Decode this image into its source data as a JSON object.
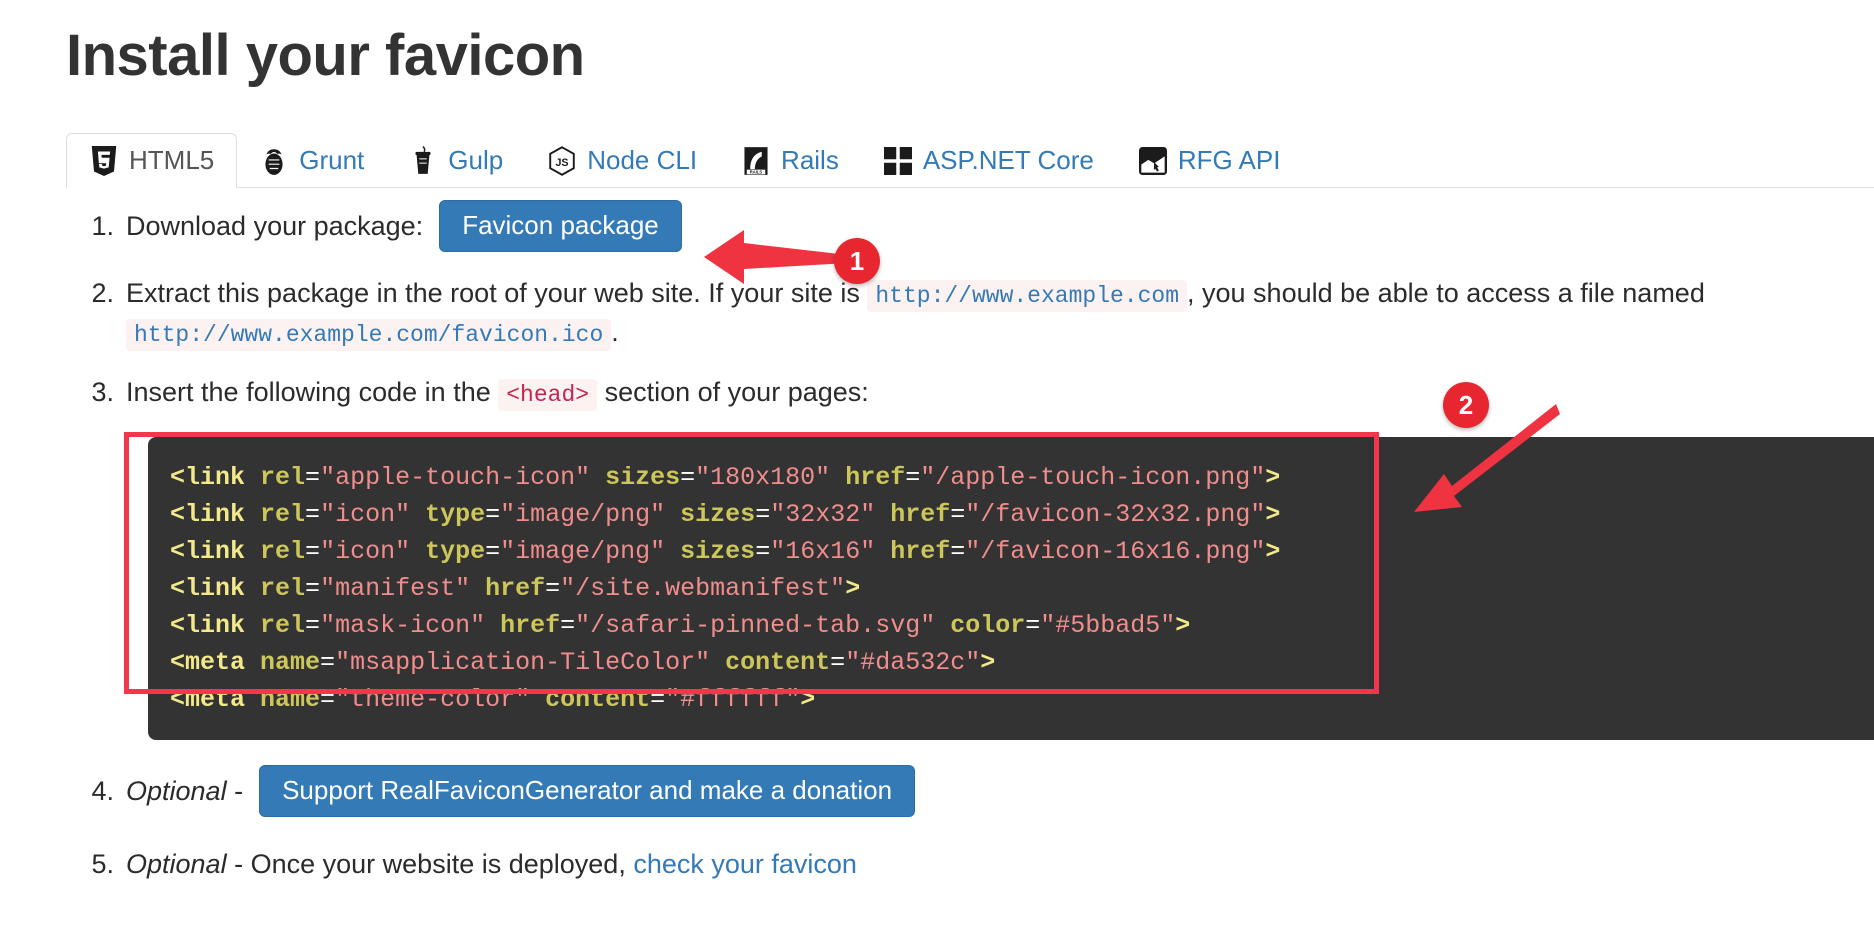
{
  "page": {
    "title": "Install your favicon",
    "accent_blue": "#337ab7",
    "annotation_red": "#e8262f",
    "code_bg": "#333333"
  },
  "tabs": [
    {
      "label": "HTML5",
      "icon": "html5-icon",
      "active": true
    },
    {
      "label": "Grunt",
      "icon": "grunt-icon",
      "active": false
    },
    {
      "label": "Gulp",
      "icon": "gulp-icon",
      "active": false
    },
    {
      "label": "Node CLI",
      "icon": "nodejs-icon",
      "active": false
    },
    {
      "label": "Rails",
      "icon": "rails-icon",
      "active": false
    },
    {
      "label": "ASP.NET Core",
      "icon": "windows-icon",
      "active": false
    },
    {
      "label": "RFG API",
      "icon": "rfg-api-icon",
      "active": false
    }
  ],
  "steps": {
    "step1": {
      "number": "1.",
      "text": "Download your package:",
      "button_label": "Favicon package"
    },
    "step2": {
      "number": "2.",
      "text_before": "Extract this package in the root of your web site. If your site is",
      "code_site": "http://www.example.com",
      "text_middle": ", you should be able to access a file named",
      "code_file": "http://www.example.com/favicon.ico",
      "text_end": "."
    },
    "step3": {
      "number": "3.",
      "text_before": "Insert the following code in the",
      "code_head": "<head>",
      "text_after": "section of your pages:"
    },
    "step4": {
      "number": "4.",
      "optional_label": "Optional",
      "dash": "-",
      "button_label": "Support RealFaviconGenerator and make a donation"
    },
    "step5": {
      "number": "5.",
      "optional_label": "Optional",
      "dash": "-",
      "text": "Once your website is deployed,",
      "link_label": "check your favicon"
    }
  },
  "code_block": {
    "language": "html",
    "lines": [
      [
        {
          "t": "tag",
          "s": "<link"
        },
        {
          "t": "sp",
          "s": " "
        },
        {
          "t": "attr",
          "s": "rel"
        },
        {
          "t": "eq",
          "s": "="
        },
        {
          "t": "val",
          "s": "\"apple-touch-icon\""
        },
        {
          "t": "sp",
          "s": " "
        },
        {
          "t": "attr",
          "s": "sizes"
        },
        {
          "t": "eq",
          "s": "="
        },
        {
          "t": "val",
          "s": "\"180x180\""
        },
        {
          "t": "sp",
          "s": " "
        },
        {
          "t": "attr",
          "s": "href"
        },
        {
          "t": "eq",
          "s": "="
        },
        {
          "t": "val",
          "s": "\"/apple-touch-icon.png\""
        },
        {
          "t": "tag",
          "s": ">"
        }
      ],
      [
        {
          "t": "tag",
          "s": "<link"
        },
        {
          "t": "sp",
          "s": " "
        },
        {
          "t": "attr",
          "s": "rel"
        },
        {
          "t": "eq",
          "s": "="
        },
        {
          "t": "val",
          "s": "\"icon\""
        },
        {
          "t": "sp",
          "s": " "
        },
        {
          "t": "attr",
          "s": "type"
        },
        {
          "t": "eq",
          "s": "="
        },
        {
          "t": "val",
          "s": "\"image/png\""
        },
        {
          "t": "sp",
          "s": " "
        },
        {
          "t": "attr",
          "s": "sizes"
        },
        {
          "t": "eq",
          "s": "="
        },
        {
          "t": "val",
          "s": "\"32x32\""
        },
        {
          "t": "sp",
          "s": " "
        },
        {
          "t": "attr",
          "s": "href"
        },
        {
          "t": "eq",
          "s": "="
        },
        {
          "t": "val",
          "s": "\"/favicon-32x32.png\""
        },
        {
          "t": "tag",
          "s": ">"
        }
      ],
      [
        {
          "t": "tag",
          "s": "<link"
        },
        {
          "t": "sp",
          "s": " "
        },
        {
          "t": "attr",
          "s": "rel"
        },
        {
          "t": "eq",
          "s": "="
        },
        {
          "t": "val",
          "s": "\"icon\""
        },
        {
          "t": "sp",
          "s": " "
        },
        {
          "t": "attr",
          "s": "type"
        },
        {
          "t": "eq",
          "s": "="
        },
        {
          "t": "val",
          "s": "\"image/png\""
        },
        {
          "t": "sp",
          "s": " "
        },
        {
          "t": "attr",
          "s": "sizes"
        },
        {
          "t": "eq",
          "s": "="
        },
        {
          "t": "val",
          "s": "\"16x16\""
        },
        {
          "t": "sp",
          "s": " "
        },
        {
          "t": "attr",
          "s": "href"
        },
        {
          "t": "eq",
          "s": "="
        },
        {
          "t": "val",
          "s": "\"/favicon-16x16.png\""
        },
        {
          "t": "tag",
          "s": ">"
        }
      ],
      [
        {
          "t": "tag",
          "s": "<link"
        },
        {
          "t": "sp",
          "s": " "
        },
        {
          "t": "attr",
          "s": "rel"
        },
        {
          "t": "eq",
          "s": "="
        },
        {
          "t": "val",
          "s": "\"manifest\""
        },
        {
          "t": "sp",
          "s": " "
        },
        {
          "t": "attr",
          "s": "href"
        },
        {
          "t": "eq",
          "s": "="
        },
        {
          "t": "val",
          "s": "\"/site.webmanifest\""
        },
        {
          "t": "tag",
          "s": ">"
        }
      ],
      [
        {
          "t": "tag",
          "s": "<link"
        },
        {
          "t": "sp",
          "s": " "
        },
        {
          "t": "attr",
          "s": "rel"
        },
        {
          "t": "eq",
          "s": "="
        },
        {
          "t": "val",
          "s": "\"mask-icon\""
        },
        {
          "t": "sp",
          "s": " "
        },
        {
          "t": "attr",
          "s": "href"
        },
        {
          "t": "eq",
          "s": "="
        },
        {
          "t": "val",
          "s": "\"/safari-pinned-tab.svg\""
        },
        {
          "t": "sp",
          "s": " "
        },
        {
          "t": "attr",
          "s": "color"
        },
        {
          "t": "eq",
          "s": "="
        },
        {
          "t": "val",
          "s": "\"#5bbad5\""
        },
        {
          "t": "tag",
          "s": ">"
        }
      ],
      [
        {
          "t": "tag",
          "s": "<meta"
        },
        {
          "t": "sp",
          "s": " "
        },
        {
          "t": "attr",
          "s": "name"
        },
        {
          "t": "eq",
          "s": "="
        },
        {
          "t": "val",
          "s": "\"msapplication-TileColor\""
        },
        {
          "t": "sp",
          "s": " "
        },
        {
          "t": "attr",
          "s": "content"
        },
        {
          "t": "eq",
          "s": "="
        },
        {
          "t": "val",
          "s": "\"#da532c\""
        },
        {
          "t": "tag",
          "s": ">"
        }
      ],
      [
        {
          "t": "tag",
          "s": "<meta"
        },
        {
          "t": "sp",
          "s": " "
        },
        {
          "t": "attr",
          "s": "name"
        },
        {
          "t": "eq",
          "s": "="
        },
        {
          "t": "val",
          "s": "\"theme-color\""
        },
        {
          "t": "sp",
          "s": " "
        },
        {
          "t": "attr",
          "s": "content"
        },
        {
          "t": "eq",
          "s": "="
        },
        {
          "t": "val",
          "s": "\"#ffffff\""
        },
        {
          "t": "tag",
          "s": ">"
        }
      ]
    ]
  },
  "annotations": [
    {
      "label": "1",
      "target": "favicon-package-button"
    },
    {
      "label": "2",
      "target": "code-block"
    }
  ]
}
